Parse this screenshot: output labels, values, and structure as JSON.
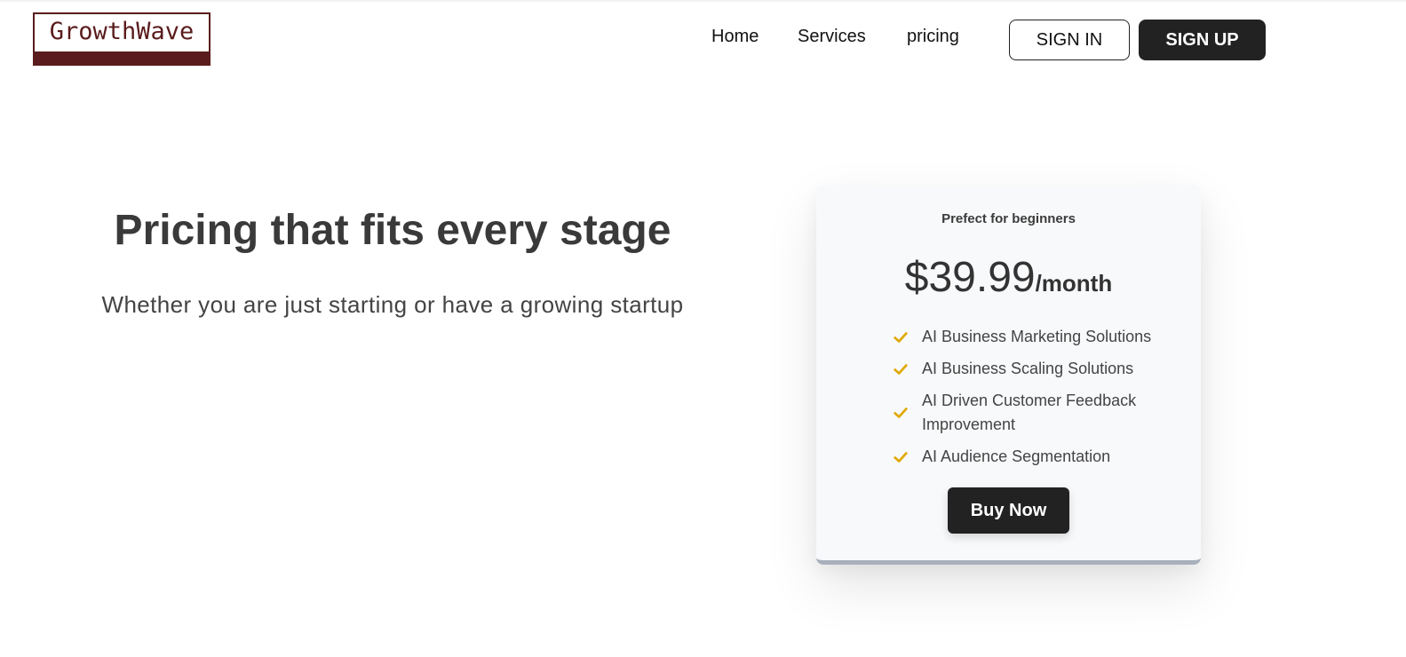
{
  "brand": {
    "name": "GrowthWave",
    "color": "#5a1c1c"
  },
  "nav": {
    "links": [
      "Home",
      "Services",
      "pricing"
    ],
    "sign_in": "SIGN IN",
    "sign_up": "SIGN UP"
  },
  "hero": {
    "title": "Pricing that fits every stage",
    "subtitle": "Whether you are just starting or have a growing startup"
  },
  "plan": {
    "tagline": "Prefect for beginners",
    "price": "$39.99",
    "period": "/month",
    "features": [
      "AI Business Marketing Solutions",
      "AI Business Scaling Solutions",
      "AI Driven Customer Feedback Improvement",
      "AI Audience Segmentation"
    ],
    "feature_icon": "check-icon",
    "accent_color": "#e0a800",
    "cta": "Buy Now"
  }
}
